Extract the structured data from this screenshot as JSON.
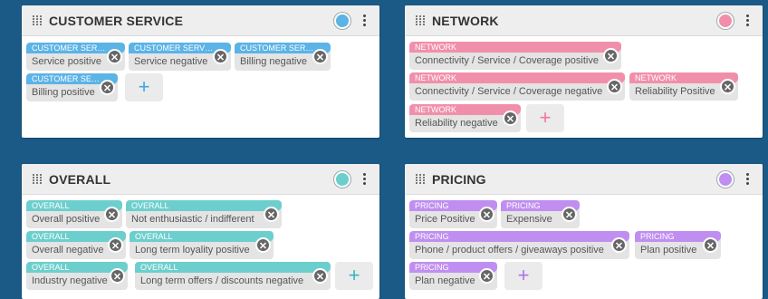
{
  "cards": [
    {
      "title": "CUSTOMER SERVICE",
      "color": "#5bb3e6",
      "chips": [
        {
          "category": "CUSTOMER SER…",
          "label": "Service positive"
        },
        {
          "category": "CUSTOMER SERV…",
          "label": "Service negative"
        },
        {
          "category": "CUSTOMER SER…",
          "label": "Billing negative"
        },
        {
          "category": "CUSTOMER SE…",
          "label": "Billing positive"
        }
      ],
      "add_label": "+"
    },
    {
      "title": "NETWORK",
      "color": "#f18fab",
      "chips": [
        {
          "category": "NETWORK",
          "label": "Connectivity / Service / Coverage positive"
        },
        {
          "category": "NETWORK",
          "label": "Connectivity / Service / Coverage negative"
        },
        {
          "category": "NETWORK",
          "label": "Reliability Positive"
        },
        {
          "category": "NETWORK",
          "label": "Reliability negative"
        }
      ],
      "add_label": "+"
    },
    {
      "title": "OVERALL",
      "color": "#6ccfcd",
      "chips": [
        {
          "category": "OVERALL",
          "label": "Overall positive"
        },
        {
          "category": "OVERALL",
          "label": "Not enthusiastic / indifferent"
        },
        {
          "category": "OVERALL",
          "label": "Overall negative"
        },
        {
          "category": "OVERALL",
          "label": "Long term loyality positive"
        },
        {
          "category": "OVERALL",
          "label": "Industry negative"
        },
        {
          "category": "OVERALL",
          "label": "Long term offers / discounts negative"
        }
      ],
      "add_label": "+"
    },
    {
      "title": "PRICING",
      "color": "#c08ef0",
      "chips": [
        {
          "category": "PRICING",
          "label": "Price Positive"
        },
        {
          "category": "PRICING",
          "label": "Expensive"
        },
        {
          "category": "PRICING",
          "label": "Phone / product offers / giveaways positive"
        },
        {
          "category": "PRICING",
          "label": "Plan positive"
        },
        {
          "category": "PRICING",
          "label": "Plan negative"
        }
      ],
      "add_label": "+"
    }
  ],
  "icons": {
    "drag": "drag-handle-icon",
    "menu": "more-vert-icon",
    "remove": "close-circle-icon",
    "add": "plus-icon"
  },
  "remove_glyph": "✕"
}
